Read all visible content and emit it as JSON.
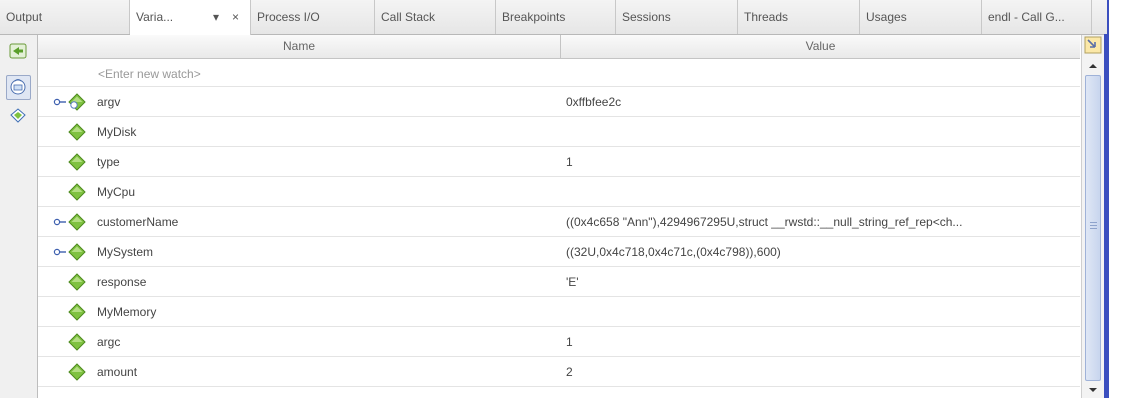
{
  "tabs": [
    {
      "label": "Output",
      "active": false
    },
    {
      "label": "Varia...",
      "active": true
    },
    {
      "label": "Process I/O",
      "active": false
    },
    {
      "label": "Call Stack",
      "active": false
    },
    {
      "label": "Breakpoints",
      "active": false
    },
    {
      "label": "Sessions",
      "active": false
    },
    {
      "label": "Threads",
      "active": false
    },
    {
      "label": "Usages",
      "active": false
    },
    {
      "label": "endl - Call G...",
      "active": false
    }
  ],
  "tab_controls": {
    "dropdown_glyph": "▾",
    "close_glyph": "×"
  },
  "toolbar": [
    {
      "icon": "new-watch-icon"
    },
    {
      "icon": "evaluate-expression-icon",
      "pressed": true
    },
    {
      "icon": "watch-bookmark-icon"
    }
  ],
  "columns": {
    "name": "Name",
    "value": "Value"
  },
  "placeholder": "<Enter new watch>",
  "variables": [
    {
      "name": "argv",
      "value": "0xffbfee2c",
      "expandable": true,
      "icon": "pointer-variable-icon"
    },
    {
      "name": "MyDisk",
      "value": "",
      "expandable": false,
      "icon": "variable-icon"
    },
    {
      "name": "type",
      "value": "1",
      "expandable": false,
      "icon": "variable-icon"
    },
    {
      "name": "MyCpu",
      "value": "",
      "expandable": false,
      "icon": "variable-icon"
    },
    {
      "name": "customerName",
      "value": "((0x4c658 \"Ann\"),4294967295U,struct __rwstd::__null_string_ref_rep<ch...",
      "expandable": true,
      "icon": "variable-icon"
    },
    {
      "name": "MySystem",
      "value": "((32U,0x4c718,0x4c71c,(0x4c798)),600)",
      "expandable": true,
      "icon": "variable-icon"
    },
    {
      "name": "response",
      "value": "'E'",
      "expandable": false,
      "icon": "variable-icon"
    },
    {
      "name": "MyMemory",
      "value": "",
      "expandable": false,
      "icon": "variable-icon"
    },
    {
      "name": "argc",
      "value": "1",
      "expandable": false,
      "icon": "variable-icon"
    },
    {
      "name": "amount",
      "value": "2",
      "expandable": false,
      "icon": "variable-icon"
    }
  ],
  "colors": {
    "accent_blue": "#3b4fbf",
    "variable_green": "#7fc241",
    "header_bg": "#efefef"
  }
}
